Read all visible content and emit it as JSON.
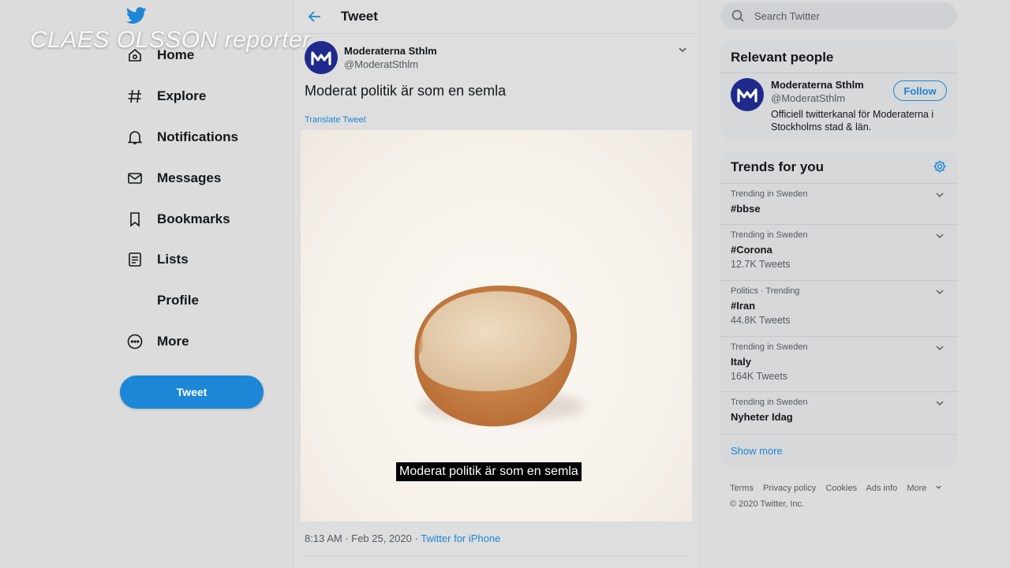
{
  "overlay": {
    "credit": "CLAES OLSSON reporter"
  },
  "colors": {
    "accent": "#1b87d6",
    "avatar_bg": "#1f2a8c"
  },
  "nav": {
    "logo_icon": "twitter-bird-icon",
    "items": [
      {
        "label": "Home",
        "icon": "home-icon"
      },
      {
        "label": "Explore",
        "icon": "hash-icon"
      },
      {
        "label": "Notifications",
        "icon": "bell-icon"
      },
      {
        "label": "Messages",
        "icon": "envelope-icon"
      },
      {
        "label": "Bookmarks",
        "icon": "bookmark-icon"
      },
      {
        "label": "Lists",
        "icon": "list-icon"
      },
      {
        "label": "Profile",
        "icon": "profile-icon"
      },
      {
        "label": "More",
        "icon": "more-icon"
      }
    ],
    "tweet_button": "Tweet"
  },
  "header": {
    "title": "Tweet",
    "back_icon": "back-arrow-icon"
  },
  "tweet": {
    "author_name": "Moderaterna Sthlm",
    "author_handle": "@ModeratSthlm",
    "text": "Moderat politik är som en semla",
    "translate_label": "Translate Tweet",
    "video_subtitle": "Moderat politik är som en semla",
    "time": "8:13 AM · Feb 25, 2020 · ",
    "source": "Twitter for iPhone"
  },
  "search": {
    "placeholder": "Search Twitter"
  },
  "relevant_people": {
    "title": "Relevant people",
    "name": "Moderaterna Sthlm",
    "handle": "@ModeratSthlm",
    "bio": "Officiell twitterkanal för Moderaterna i Stockholms stad & län.",
    "follow_label": "Follow"
  },
  "trends": {
    "title": "Trends for you",
    "items": [
      {
        "meta": "Trending in Sweden",
        "name": "#bbse",
        "count": ""
      },
      {
        "meta": "Trending in Sweden",
        "name": "#Corona",
        "count": "12.7K Tweets"
      },
      {
        "meta": "Politics · Trending",
        "name": "#Iran",
        "count": "44.8K Tweets"
      },
      {
        "meta": "Trending in Sweden",
        "name": "Italy",
        "count": "164K Tweets"
      },
      {
        "meta": "Trending in Sweden",
        "name": "Nyheter Idag",
        "count": ""
      }
    ],
    "show_more": "Show more"
  },
  "footer": {
    "links": [
      "Terms",
      "Privacy policy",
      "Cookies",
      "Ads info",
      "More"
    ],
    "copyright": "© 2020 Twitter, Inc."
  }
}
